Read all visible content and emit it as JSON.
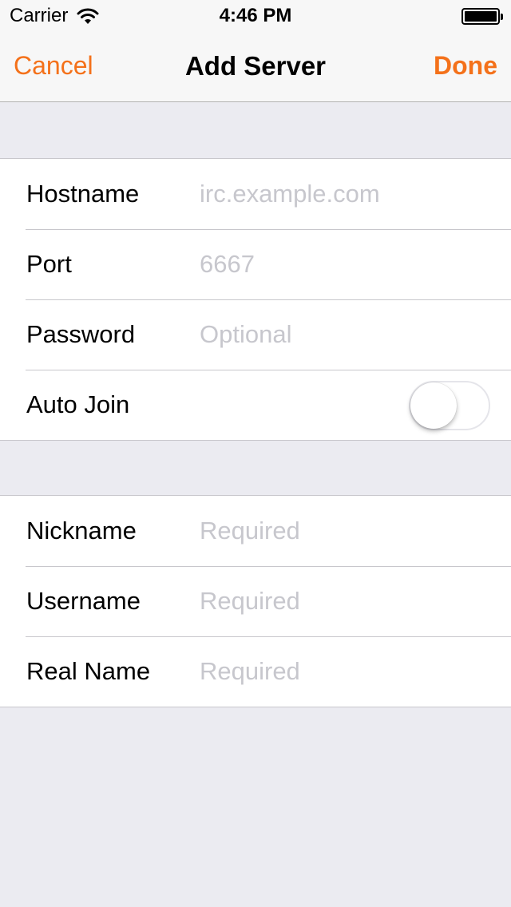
{
  "status_bar": {
    "carrier": "Carrier",
    "time": "4:46 PM",
    "wifi_icon": "wifi-icon",
    "battery_icon": "battery-icon"
  },
  "nav": {
    "cancel_label": "Cancel",
    "title": "Add Server",
    "done_label": "Done"
  },
  "colors": {
    "accent": "#F4711A",
    "background": "#EBEBF1"
  },
  "server_section": {
    "hostname": {
      "label": "Hostname",
      "placeholder": "irc.example.com",
      "value": ""
    },
    "port": {
      "label": "Port",
      "placeholder": "6667",
      "value": ""
    },
    "password": {
      "label": "Password",
      "placeholder": "Optional",
      "value": ""
    },
    "auto_join": {
      "label": "Auto Join",
      "on": false
    }
  },
  "identity_section": {
    "nickname": {
      "label": "Nickname",
      "placeholder": "Required",
      "value": ""
    },
    "username": {
      "label": "Username",
      "placeholder": "Required",
      "value": ""
    },
    "real_name": {
      "label": "Real Name",
      "placeholder": "Required",
      "value": ""
    }
  }
}
